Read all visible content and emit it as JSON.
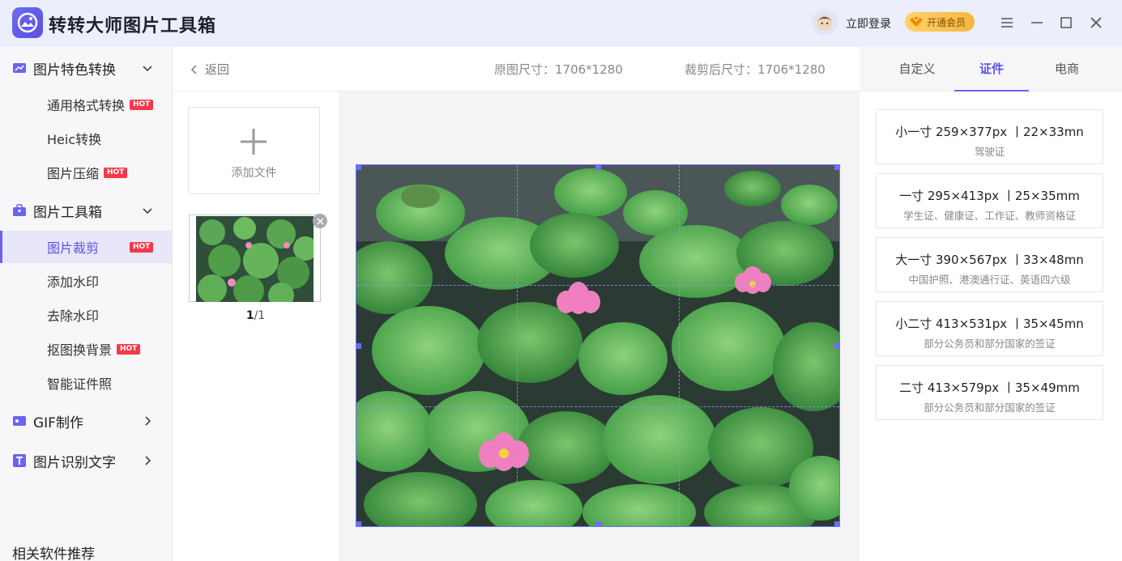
{
  "app": {
    "title": "转转大师图片工具箱"
  },
  "header": {
    "login_label": "立即登录",
    "vip_label": "开通会员"
  },
  "sidebar": {
    "groups": [
      {
        "label": "图片特色转换",
        "icon": "image-convert-icon"
      },
      {
        "label": "图片工具箱",
        "icon": "toolbox-icon"
      },
      {
        "label": "GIF制作",
        "icon": "gif-icon"
      },
      {
        "label": "图片识别文字",
        "icon": "text-recognition-icon"
      }
    ],
    "items": [
      {
        "label": "通用格式转换",
        "hot": "HOT"
      },
      {
        "label": "Heic转换"
      },
      {
        "label": "图片压缩",
        "hot": "HOT"
      },
      {
        "label": "图片裁剪",
        "hot": "HOT"
      },
      {
        "label": "添加水印"
      },
      {
        "label": "去除水印"
      },
      {
        "label": "抠图换背景",
        "hot": "HOT"
      },
      {
        "label": "智能证件照"
      }
    ],
    "recommend_label": "相关软件推荐"
  },
  "infobar": {
    "back_label": "返回",
    "original_size": "原图尺寸：1706*1280",
    "cropped_size": "裁剪后尺寸：1706*1280"
  },
  "files": {
    "add_label": "添加文件",
    "current": "1",
    "total": "/1"
  },
  "tabs": [
    "自定义",
    "证件",
    "电商"
  ],
  "size_options": [
    {
      "title": "小一寸 259×377px 丨22×33mn",
      "desc": "驾驶证"
    },
    {
      "title": "一寸 295×413px 丨25×35mm",
      "desc": "学生证、健康证、工作证、教师资格证"
    },
    {
      "title": "大一寸 390×567px 丨33×48mn",
      "desc": "中国护照、港澳通行证、英语四六级"
    },
    {
      "title": "小二寸 413×531px 丨35×45mn",
      "desc": "部分公务员和部分国家的签证"
    },
    {
      "title": "二寸 413×579px 丨35×49mm",
      "desc": "部分公务员和部分国家的签证"
    }
  ],
  "colors": {
    "accent": "#6c63ef",
    "hot": "#f5394a"
  }
}
